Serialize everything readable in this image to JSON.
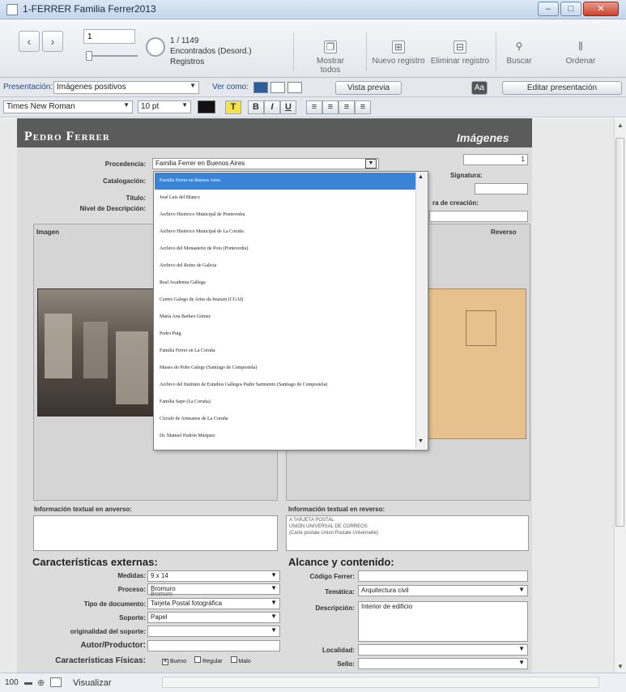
{
  "window": {
    "title": "1-FERRER Familia Ferrer2013"
  },
  "toolbar": {
    "record_input": "1",
    "record_position": "1 / 1149",
    "found_text": "Encontrados (Desord.)",
    "records_label": "Registros",
    "buttons": [
      "Mostrar todos",
      "Nuevo registro",
      "Eliminar registro",
      "Buscar",
      "Ordenar"
    ]
  },
  "layoutbar": {
    "layout_label": "Presentación:",
    "layout_value": "Imágenes positivos",
    "view_as_label": "Ver como:",
    "preview_button": "Vista previa",
    "edit_layout_button": "Editar presentación"
  },
  "formatbar": {
    "font": "Times New Roman",
    "size": "10 pt",
    "bold": "B",
    "italic": "I",
    "underline": "U",
    "text_tool": "T"
  },
  "header": {
    "record_name": "Pedro Ferrer",
    "section": "Imágenes"
  },
  "form": {
    "labels": {
      "procedencia": "Procedencia:",
      "catalogacion": "Catalogación:",
      "titulo": "Título:",
      "nivel": "Nivel de Descripción:",
      "signatura": "Signatura:",
      "fecha_creacion": "ra de creación:",
      "imagen": "Imagen",
      "reverso": "Reverso",
      "info_anverso": "Información textual en anverso:",
      "info_reverso": "Información textual en reverso:"
    },
    "procedencia_value": "Familia Ferrer en Buenos Aires",
    "number_value": "1",
    "reverso_text": [
      "A TARJETA POSTAL",
      "UNIÓN UNIVERSAL DE CORREOS",
      "(Carte postale Union Postale Universelle)"
    ]
  },
  "dropdown": {
    "items": [
      "Familia Ferrer en Buenos Aires",
      "José Luis del Blanco",
      "Archivo Histórico Municipal de Pontevedra",
      "Archivo Histórico Municipal de La Coruña",
      "Archivo del Monasterio de Poio (Pontevedra)",
      "Archivo del Reino de Galicia",
      "Real Academia Gallega",
      "Centro Galego de Artes da Imaxen (CGAI)",
      "María Ana Barbeo Gómez",
      "Pedro Puig",
      "Familia Ferrer en La Coruña",
      "Museo do Pobo Galego (Santiago de Compostela)",
      "Archivo del Instituto de Estudios Gallegos Padre Sarmiento (Santiago de Compostela)",
      "Familia Sapo (La Coruña)",
      "Círculo de Artesanos de La Coruña",
      "Dr. Manuel Padrón Márquez"
    ],
    "selected_index": 0
  },
  "externas": {
    "heading": "Características externas:",
    "labels": [
      "Medidas:",
      "Proceso:",
      "Tipo de documento:",
      "Soporte:",
      "originalidad del soporte:",
      "Autor/Productor:",
      "Características Físicas:"
    ],
    "values": [
      "9 x 14",
      "Bromuro",
      "Tarjeta Postal fotográfica",
      "Papel",
      "",
      "",
      ""
    ],
    "proceso_overlay": "Bromuro",
    "estado": [
      "Bueno",
      "Regular",
      "Malo"
    ]
  },
  "alcance": {
    "heading": "Alcance y contenido:",
    "labels": [
      "Código Ferrer:",
      "Temática:",
      "Descripción:",
      "Localidad:",
      "Sello:"
    ],
    "tematica": "Arquitectura civil",
    "descripcion": "Interior de edificio"
  },
  "statusbar": {
    "zoom": "100",
    "mode": "Visualizar"
  }
}
